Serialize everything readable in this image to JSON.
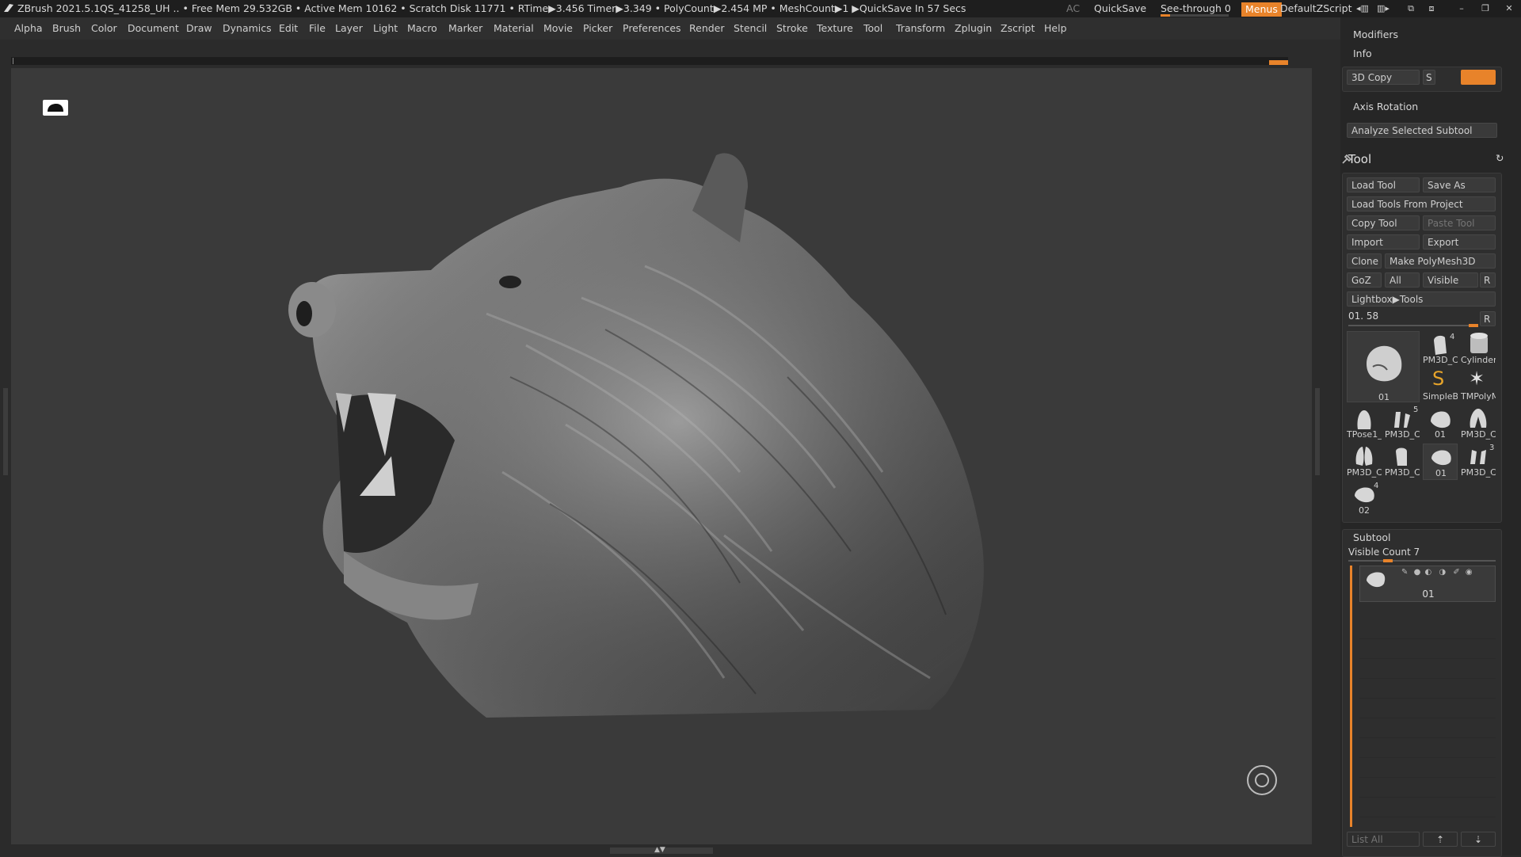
{
  "titlebar": {
    "app": "ZBrush 2021.5.1",
    "stats": "QS_41258_UH  .. • Free Mem 29.532GB • Active Mem 10162 • Scratch Disk 11771 •  RTime▶3.456 Timer▶3.349 • PolyCount▶2.454 MP  • MeshCount▶1  ▶QuickSave In 57 Secs",
    "ac": "AC",
    "quicksave": "QuickSave",
    "seethrough": "See-through  0",
    "menus": "Menus",
    "script": "DefaultZScript"
  },
  "menubar": {
    "items": [
      "Alpha",
      "Brush",
      "Color",
      "Document",
      "Draw",
      "Dynamics",
      "Edit",
      "File",
      "Layer",
      "Light",
      "Macro",
      "Marker",
      "Material",
      "Movie",
      "Picker",
      "Preferences",
      "Render",
      "Stencil",
      "Stroke",
      "Texture",
      "Tool",
      "Transform",
      "Zplugin",
      "Zscript",
      "Help"
    ]
  },
  "rightpanel": {
    "modifiers": "Modifiers",
    "info": "Info",
    "copy3d": "3D Copy",
    "s_label": "S",
    "axis_rotation": "Axis Rotation",
    "analyze": "Analyze Selected Subtool",
    "tool_title": "Tool",
    "buttons": {
      "load_tool": "Load Tool",
      "save_as": "Save As",
      "load_from_project": "Load Tools From Project",
      "copy_tool": "Copy Tool",
      "paste_tool": "Paste Tool",
      "import": "Import",
      "export": "Export",
      "clone": "Clone",
      "make_polymesh": "Make PolyMesh3D",
      "goz": "GoZ",
      "all": "All",
      "visible": "Visible",
      "r": "R",
      "lightbox_tools": "Lightbox▶Tools"
    },
    "tool_slider": "01. 58",
    "tool_slider_r": "R",
    "thumbs": {
      "main": "01",
      "pm3d_1": "PM3D_C",
      "cylinder": "Cylinder",
      "simpleb": "SimpleB",
      "tmpoly": "TMPolyM",
      "tpose": "TPose1_",
      "pm3d_2": "PM3D_C",
      "t01a": "01",
      "pm3d_3": "PM3D_C",
      "pm3d_4": "PM3D_C",
      "pm3d_5": "PM3D_C",
      "t01b": "01",
      "pm3d_6": "PM3D_C",
      "t02": "02"
    },
    "badges": {
      "b4": "4",
      "b5": "5",
      "b3": "3",
      "b4b": "4"
    },
    "subtool_title": "Subtool",
    "visible_count": "Visible Count 7",
    "subtool_name": "01",
    "list_all": "List All"
  },
  "colors": {
    "accent": "#e8832a",
    "panel_bg": "#262626",
    "canvas_bg": "#3a3a3a"
  }
}
